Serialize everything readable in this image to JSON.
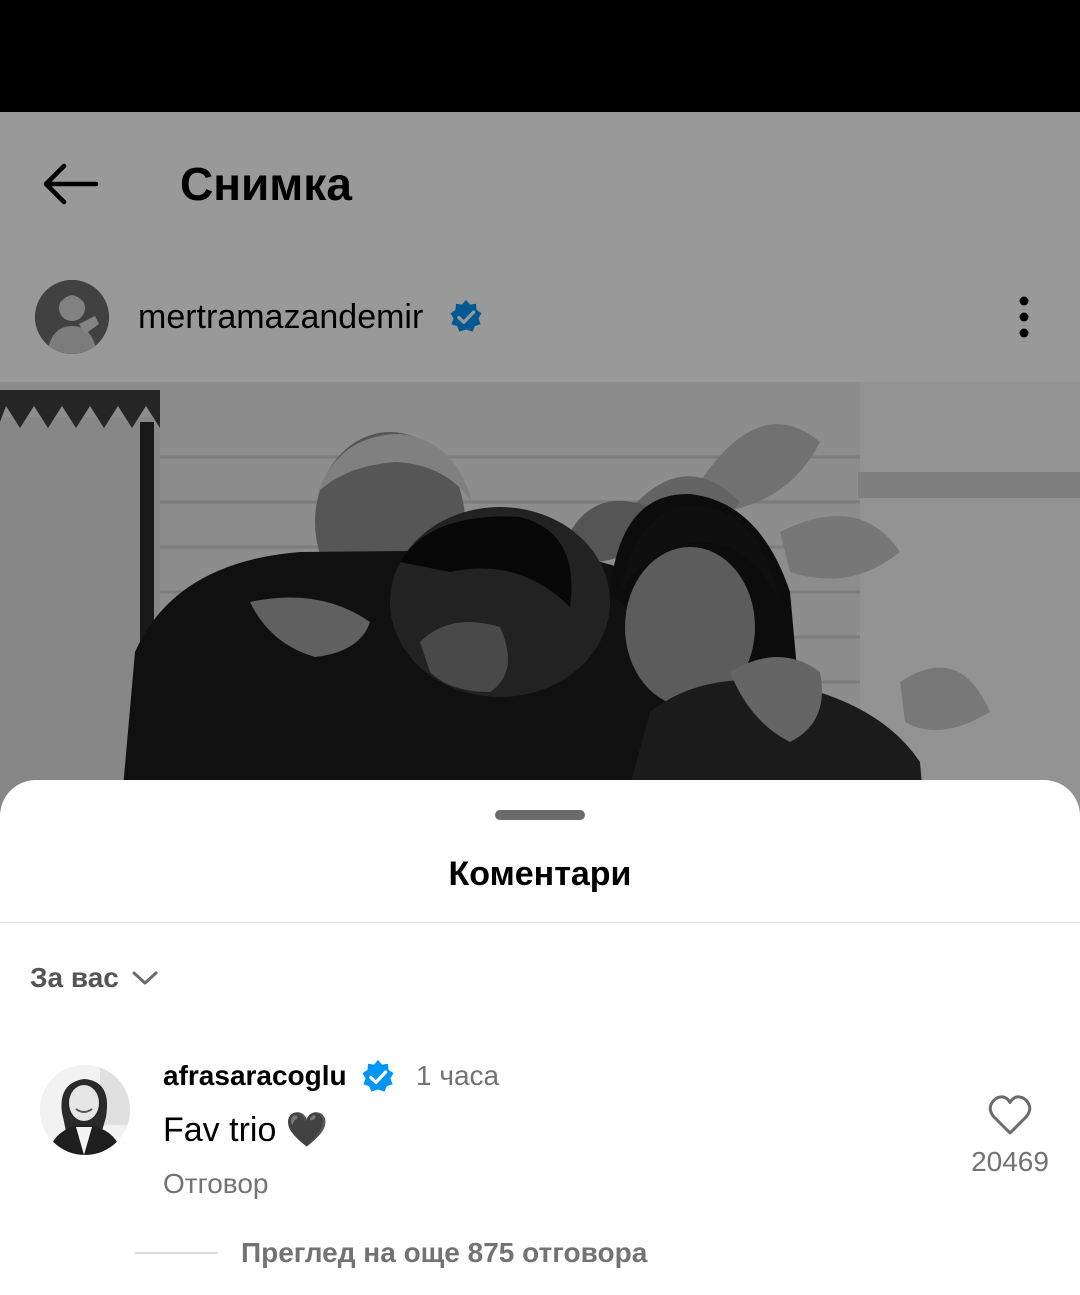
{
  "header": {
    "title": "Снимка",
    "back_icon": "arrow-left-icon"
  },
  "post": {
    "username": "mertramazandemir",
    "verified": true,
    "more_icon": "more-vertical-icon"
  },
  "comments_sheet": {
    "title": "Коментари",
    "filter_label": "За вас",
    "filter_icon": "chevron-down-icon",
    "comment": {
      "username": "afrasaracoglu",
      "verified": true,
      "time": "1 часа",
      "text": "Fav trio 🖤",
      "reply_label": "Отговор",
      "like_count": "20469",
      "like_icon": "heart-outline-icon"
    },
    "view_replies_label": "Преглед на още 875 отговора"
  },
  "colors": {
    "verified_blue": "#0095f6",
    "muted_text": "#737373",
    "divider": "#dbdbdb",
    "overlay": "rgba(0,0,0,0.4)"
  }
}
